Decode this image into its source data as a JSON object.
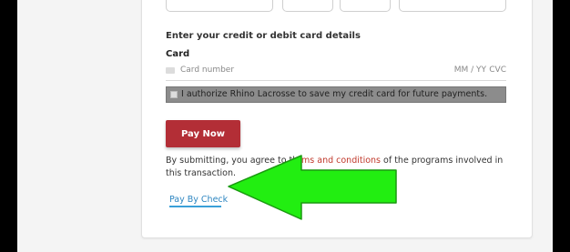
{
  "form": {
    "section_title": "Enter your credit or debit card details",
    "card_label": "Card",
    "card_number_placeholder": "Card number",
    "expiry_placeholder": "MM / YY",
    "cvc_placeholder": "CVC",
    "authorize_text": "I authorize Rhino Lacrosse to save my credit card for future payments.",
    "pay_button": "Pay Now",
    "disclaimer_before": "By submitting, you agree to th",
    "terms_link": "rms and conditions",
    "disclaimer_after": " of the programs involved in this transaction.",
    "pay_by_check": "Pay By Check"
  },
  "colors": {
    "pay_button": "#b32e36",
    "link": "#2e86c1",
    "terms_link": "#c0392b",
    "arrow": "#22ee11"
  },
  "icons": {
    "card": "credit-card-icon",
    "arrow": "green-arrow-left"
  }
}
